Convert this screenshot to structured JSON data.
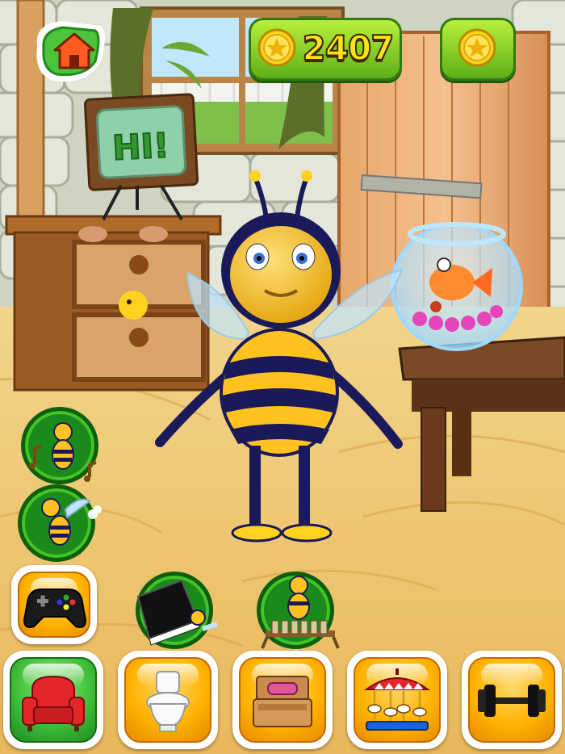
{
  "hud": {
    "coins": "2407",
    "home_icon": "house-icon",
    "coin_icon": "star-coin-icon"
  },
  "tv": {
    "screen_text": "HI!"
  },
  "side_activities": [
    {
      "name": "music-bee-icon"
    },
    {
      "name": "flying-bee-icon"
    },
    {
      "name": "piano-icon"
    },
    {
      "name": "xylophone-icon"
    }
  ],
  "bottom_menu": [
    {
      "name": "armchair-icon",
      "active": true
    },
    {
      "name": "toilet-icon",
      "active": false
    },
    {
      "name": "bed-icon",
      "active": false
    },
    {
      "name": "carousel-icon",
      "active": false
    },
    {
      "name": "dumbbell-icon",
      "active": false
    }
  ],
  "games_button": {
    "name": "gamepad-icon"
  },
  "colors": {
    "hud_green": "#6cc01f",
    "coin_text": "#ffe21a",
    "menu_orange": "#ffb300",
    "menu_green_active": "#3fbf3a"
  }
}
